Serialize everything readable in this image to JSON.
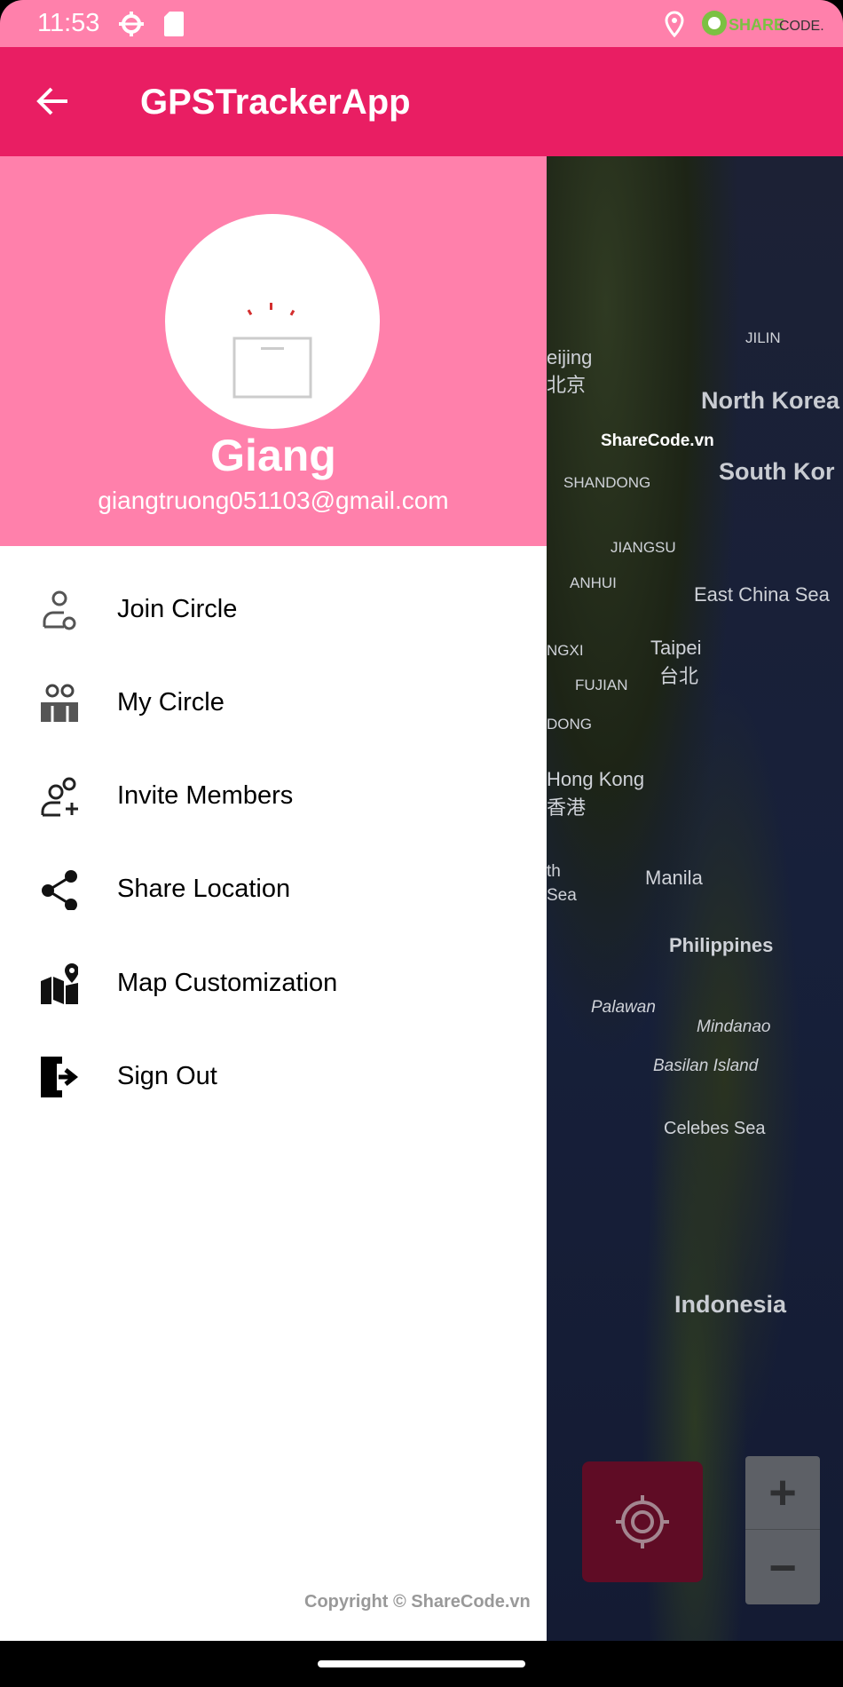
{
  "status_bar": {
    "time": "11:53",
    "icons": [
      "settings-icon",
      "sd-card-icon",
      "location-icon"
    ],
    "watermark": "SHARECODE.vn"
  },
  "app_bar": {
    "title": "GPSTrackerApp",
    "back_icon": "arrow-left-icon"
  },
  "drawer": {
    "user": {
      "name": "Giang",
      "email": "giangtruong051103@gmail.com"
    },
    "items": [
      {
        "label": "Join Circle",
        "icon": "person-join-icon"
      },
      {
        "label": "My Circle",
        "icon": "group-icon"
      },
      {
        "label": "Invite Members",
        "icon": "person-add-icon"
      },
      {
        "label": "Share Location",
        "icon": "share-icon"
      },
      {
        "label": "Map Customization",
        "icon": "map-pin-icon"
      },
      {
        "label": "Sign Out",
        "icon": "exit-icon"
      }
    ],
    "copyright": "Copyright © ShareCode.vn"
  },
  "map": {
    "labels": [
      "JILIN",
      "North Korea",
      "ShareCode.vn",
      "South Kor",
      "eijing",
      "北京",
      "SHANDONG",
      "JIANGSU",
      "ANHUI",
      "East China Sea",
      "NGXI",
      "Taipei",
      "台北",
      "FUJIAN",
      "DONG",
      "Hong Kong",
      "香港",
      "th",
      "Sea",
      "Manila",
      "Philippines",
      "Palawan",
      "Mindanao",
      "Basilan Island",
      "Celebes Sea",
      "Indonesia"
    ],
    "locate_icon": "my-location-icon",
    "zoom_in": "+",
    "zoom_out": "−"
  }
}
